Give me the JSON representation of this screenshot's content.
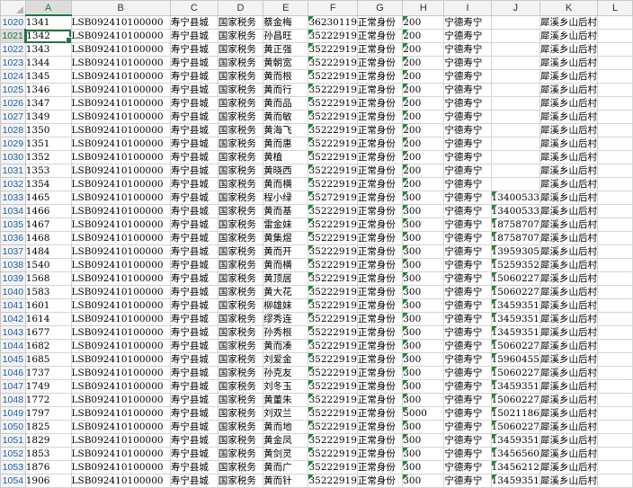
{
  "columns": [
    "A",
    "B",
    "C",
    "D",
    "E",
    "F",
    "G",
    "H",
    "I",
    "J",
    "K",
    "L"
  ],
  "active_cell": {
    "col": "A",
    "row": "1021"
  },
  "rows": [
    {
      "n": "1020",
      "A": "1341",
      "B": "LSB092410100000",
      "C": "寿宁县城",
      "D": "国家税务",
      "E": "蔡金梅",
      "F": "36230119",
      "G": "正常身份",
      "H": "200",
      "I": "宁德寿宁",
      "J": "",
      "K": "犀溪乡山后村",
      "L": "",
      "gf": true,
      "gh": true,
      "gj": false
    },
    {
      "n": "1021",
      "A": "1342",
      "B": "LSB092410100000",
      "C": "寿宁县城",
      "D": "国家税务",
      "E": "孙昌旺",
      "F": "35222919",
      "G": "正常身份",
      "H": "200",
      "I": "宁德寿宁",
      "J": "",
      "K": "犀溪乡山后村",
      "L": "",
      "gf": true,
      "gh": true,
      "gj": false
    },
    {
      "n": "1022",
      "A": "1343",
      "B": "LSB092410100000",
      "C": "寿宁县城",
      "D": "国家税务",
      "E": "黄正强",
      "F": "35222919",
      "G": "正常身份",
      "H": "200",
      "I": "宁德寿宁",
      "J": "",
      "K": "犀溪乡山后村",
      "L": "",
      "gf": true,
      "gh": true,
      "gj": false
    },
    {
      "n": "1023",
      "A": "1344",
      "B": "LSB092410100000",
      "C": "寿宁县城",
      "D": "国家税务",
      "E": "黄朝宽",
      "F": "35222919",
      "G": "正常身份",
      "H": "200",
      "I": "宁德寿宁",
      "J": "",
      "K": "犀溪乡山后村",
      "L": "",
      "gf": true,
      "gh": true,
      "gj": false
    },
    {
      "n": "1024",
      "A": "1345",
      "B": "LSB092410100000",
      "C": "寿宁县城",
      "D": "国家税务",
      "E": "黄而根",
      "F": "35222919",
      "G": "正常身份",
      "H": "200",
      "I": "宁德寿宁",
      "J": "",
      "K": "犀溪乡山后村",
      "L": "",
      "gf": true,
      "gh": true,
      "gj": false
    },
    {
      "n": "1025",
      "A": "1346",
      "B": "LSB092410100000",
      "C": "寿宁县城",
      "D": "国家税务",
      "E": "黄而行",
      "F": "35222919",
      "G": "正常身份",
      "H": "200",
      "I": "宁德寿宁",
      "J": "",
      "K": "犀溪乡山后村",
      "L": "",
      "gf": true,
      "gh": true,
      "gj": false
    },
    {
      "n": "1026",
      "A": "1347",
      "B": "LSB092410100000",
      "C": "寿宁县城",
      "D": "国家税务",
      "E": "黄而品",
      "F": "35222919",
      "G": "正常身份",
      "H": "200",
      "I": "宁德寿宁",
      "J": "",
      "K": "犀溪乡山后村",
      "L": "",
      "gf": true,
      "gh": true,
      "gj": false
    },
    {
      "n": "1027",
      "A": "1349",
      "B": "LSB092410100000",
      "C": "寿宁县城",
      "D": "国家税务",
      "E": "黄而敏",
      "F": "35222919",
      "G": "正常身份",
      "H": "200",
      "I": "宁德寿宁",
      "J": "",
      "K": "犀溪乡山后村",
      "L": "",
      "gf": true,
      "gh": true,
      "gj": false
    },
    {
      "n": "1028",
      "A": "1350",
      "B": "LSB092410100000",
      "C": "寿宁县城",
      "D": "国家税务",
      "E": "黄海飞",
      "F": "35222919",
      "G": "正常身份",
      "H": "200",
      "I": "宁德寿宁",
      "J": "",
      "K": "犀溪乡山后村",
      "L": "",
      "gf": true,
      "gh": true,
      "gj": false
    },
    {
      "n": "1029",
      "A": "1351",
      "B": "LSB092410100000",
      "C": "寿宁县城",
      "D": "国家税务",
      "E": "黄而惠",
      "F": "35222919",
      "G": "正常身份",
      "H": "200",
      "I": "宁德寿宁",
      "J": "",
      "K": "犀溪乡山后村",
      "L": "",
      "gf": true,
      "gh": true,
      "gj": false
    },
    {
      "n": "1030",
      "A": "1352",
      "B": "LSB092410100000",
      "C": "寿宁县城",
      "D": "国家税务",
      "E": "黄植",
      "F": "35222919",
      "G": "正常身份",
      "H": "200",
      "I": "宁德寿宁",
      "J": "",
      "K": "犀溪乡山后村",
      "L": "",
      "gf": true,
      "gh": true,
      "gj": false
    },
    {
      "n": "1031",
      "A": "1353",
      "B": "LSB092410100000",
      "C": "寿宁县城",
      "D": "国家税务",
      "E": "黄晓西",
      "F": "35222919",
      "G": "正常身份",
      "H": "200",
      "I": "宁德寿宁",
      "J": "",
      "K": "犀溪乡山后村",
      "L": "",
      "gf": true,
      "gh": true,
      "gj": false
    },
    {
      "n": "1032",
      "A": "1354",
      "B": "LSB092410100000",
      "C": "寿宁县城",
      "D": "国家税务",
      "E": "黄而横",
      "F": "35222919",
      "G": "正常身份",
      "H": "200",
      "I": "宁德寿宁",
      "J": "",
      "K": "犀溪乡山后村",
      "L": "",
      "gf": true,
      "gh": true,
      "gj": false
    },
    {
      "n": "1033",
      "A": "1465",
      "B": "LSB092410100000",
      "C": "寿宁县城",
      "D": "国家税务",
      "E": "程小绿",
      "F": "35272919",
      "G": "正常身份",
      "H": "300",
      "I": "宁德寿宁",
      "J": "13400533",
      "K": "犀溪乡山后村",
      "L": "",
      "gf": true,
      "gh": true,
      "gj": true
    },
    {
      "n": "1034",
      "A": "1466",
      "B": "LSB092410100000",
      "C": "寿宁县城",
      "D": "国家税务",
      "E": "黄而基",
      "F": "35222919",
      "G": "正常身份",
      "H": "300",
      "I": "宁德寿宁",
      "J": "13400533",
      "K": "犀溪乡山后村",
      "L": "",
      "gf": true,
      "gh": true,
      "gj": true
    },
    {
      "n": "1035",
      "A": "1467",
      "B": "LSB092410100000",
      "C": "寿宁县城",
      "D": "国家税务",
      "E": "雷金妹",
      "F": "35222919",
      "G": "正常身份",
      "H": "300",
      "I": "宁德寿宁",
      "J": "18758707",
      "K": "犀溪乡山后村",
      "L": "",
      "gf": true,
      "gh": true,
      "gj": true
    },
    {
      "n": "1036",
      "A": "1468",
      "B": "LSB092410100000",
      "C": "寿宁县城",
      "D": "国家税务",
      "E": "黄集煜",
      "F": "35222919",
      "G": "正常身份",
      "H": "300",
      "I": "宁德寿宁",
      "J": "18758707",
      "K": "犀溪乡山后村",
      "L": "",
      "gf": true,
      "gh": true,
      "gj": true
    },
    {
      "n": "1037",
      "A": "1484",
      "B": "LSB092410100000",
      "C": "寿宁县城",
      "D": "国家税务",
      "E": "黄而开",
      "F": "35222919",
      "G": "正常身份",
      "H": "300",
      "I": "宁德寿宁",
      "J": "13959305",
      "K": "犀溪乡山后村",
      "L": "",
      "gf": true,
      "gh": true,
      "gj": true
    },
    {
      "n": "1038",
      "A": "1540",
      "B": "LSB092410100000",
      "C": "寿宁县城",
      "D": "国家税务",
      "E": "黄而横",
      "F": "35222919",
      "G": "正常身份",
      "H": "300",
      "I": "宁德寿宁",
      "J": "15259352",
      "K": "犀溪乡山后村",
      "L": "",
      "gf": true,
      "gh": true,
      "gj": true
    },
    {
      "n": "1039",
      "A": "1568",
      "B": "LSB092410100000",
      "C": "寿宁县城",
      "D": "国家税务",
      "E": "黄顶居",
      "F": "35222919",
      "G": "正常身份",
      "H": "300",
      "I": "宁德寿宁",
      "J": "15060227",
      "K": "犀溪乡山后村",
      "L": "",
      "gf": true,
      "gh": true,
      "gj": true
    },
    {
      "n": "1040",
      "A": "1583",
      "B": "LSB092410100000",
      "C": "寿宁县城",
      "D": "国家税务",
      "E": "黄大花",
      "F": "35222919",
      "G": "正常身份",
      "H": "300",
      "I": "宁德寿宁",
      "J": "15060227",
      "K": "犀溪乡山后村",
      "L": "",
      "gf": true,
      "gh": true,
      "gj": true
    },
    {
      "n": "1041",
      "A": "1601",
      "B": "LSB092410100000",
      "C": "寿宁县城",
      "D": "国家税务",
      "E": "柳雄妹",
      "F": "35222919",
      "G": "正常身份",
      "H": "300",
      "I": "宁德寿宁",
      "J": "13459351",
      "K": "犀溪乡山后村",
      "L": "",
      "gf": true,
      "gh": true,
      "gj": true
    },
    {
      "n": "1042",
      "A": "1614",
      "B": "LSB092410100000",
      "C": "寿宁县城",
      "D": "国家税务",
      "E": "缪秀连",
      "F": "35222919",
      "G": "正常身份",
      "H": "300",
      "I": "宁德寿宁",
      "J": "13459351",
      "K": "犀溪乡山后村",
      "L": "",
      "gf": true,
      "gh": true,
      "gj": true
    },
    {
      "n": "1043",
      "A": "1677",
      "B": "LSB092410100000",
      "C": "寿宁县城",
      "D": "国家税务",
      "E": "孙秀根",
      "F": "35222919",
      "G": "正常身份",
      "H": "300",
      "I": "宁德寿宁",
      "J": "13459351",
      "K": "犀溪乡山后村",
      "L": "",
      "gf": true,
      "gh": true,
      "gj": true
    },
    {
      "n": "1044",
      "A": "1682",
      "B": "LSB092410100000",
      "C": "寿宁县城",
      "D": "国家税务",
      "E": "黄而凑",
      "F": "35222919",
      "G": "正常身份",
      "H": "300",
      "I": "宁德寿宁",
      "J": "15060227",
      "K": "犀溪乡山后村",
      "L": "",
      "gf": true,
      "gh": true,
      "gj": true
    },
    {
      "n": "1045",
      "A": "1685",
      "B": "LSB092410100000",
      "C": "寿宁县城",
      "D": "国家税务",
      "E": "刘爱金",
      "F": "35222919",
      "G": "正常身份",
      "H": "300",
      "I": "宁德寿宁",
      "J": "15960455",
      "K": "犀溪乡山后村",
      "L": "",
      "gf": true,
      "gh": true,
      "gj": true
    },
    {
      "n": "1046",
      "A": "1737",
      "B": "LSB092410100000",
      "C": "寿宁县城",
      "D": "国家税务",
      "E": "孙克友",
      "F": "35222919",
      "G": "正常身份",
      "H": "300",
      "I": "宁德寿宁",
      "J": "15060227",
      "K": "犀溪乡山后村",
      "L": "",
      "gf": true,
      "gh": true,
      "gj": true
    },
    {
      "n": "1047",
      "A": "1749",
      "B": "LSB092410100000",
      "C": "寿宁县城",
      "D": "国家税务",
      "E": "刘冬玉",
      "F": "35222919",
      "G": "正常身份",
      "H": "300",
      "I": "宁德寿宁",
      "J": "13459351",
      "K": "犀溪乡山后村",
      "L": "",
      "gf": true,
      "gh": true,
      "gj": true
    },
    {
      "n": "1048",
      "A": "1772",
      "B": "LSB092410100000",
      "C": "寿宁县城",
      "D": "国家税务",
      "E": "黄董朱",
      "F": "35222919",
      "G": "正常身份",
      "H": "300",
      "I": "宁德寿宁",
      "J": "15060227",
      "K": "犀溪乡山后村",
      "L": "",
      "gf": true,
      "gh": true,
      "gj": true
    },
    {
      "n": "1049",
      "A": "1797",
      "B": "LSB092410100000",
      "C": "寿宁县城",
      "D": "国家税务",
      "E": "刘双兰",
      "F": "35222919",
      "G": "正常身份",
      "H": "5000",
      "I": "宁德寿宁",
      "J": "15021186",
      "K": "犀溪乡山后村",
      "L": "",
      "gf": true,
      "gh": true,
      "gj": true
    },
    {
      "n": "1050",
      "A": "1825",
      "B": "LSB092410100000",
      "C": "寿宁县城",
      "D": "国家税务",
      "E": "黄而地",
      "F": "35222919",
      "G": "正常身份",
      "H": "300",
      "I": "宁德寿宁",
      "J": "15060227",
      "K": "犀溪乡山后村",
      "L": "",
      "gf": true,
      "gh": true,
      "gj": true
    },
    {
      "n": "1051",
      "A": "1829",
      "B": "LSB092410100000",
      "C": "寿宁县城",
      "D": "国家税务",
      "E": "黄金凤",
      "F": "35222919",
      "G": "正常身份",
      "H": "300",
      "I": "宁德寿宁",
      "J": "13459351",
      "K": "犀溪乡山后村",
      "L": "",
      "gf": true,
      "gh": true,
      "gj": true
    },
    {
      "n": "1052",
      "A": "1853",
      "B": "LSB092410100000",
      "C": "寿宁县城",
      "D": "国家税务",
      "E": "黄剑灵",
      "F": "35222919",
      "G": "正常身份",
      "H": "300",
      "I": "宁德寿宁",
      "J": "13456560",
      "K": "犀溪乡山后村",
      "L": "",
      "gf": true,
      "gh": true,
      "gj": true
    },
    {
      "n": "1053",
      "A": "1876",
      "B": "LSB092410100000",
      "C": "寿宁县城",
      "D": "国家税务",
      "E": "黄而广",
      "F": "35222919",
      "G": "正常身份",
      "H": "300",
      "I": "宁德寿宁",
      "J": "13456212",
      "K": "犀溪乡山后村",
      "L": "",
      "gf": true,
      "gh": true,
      "gj": true
    },
    {
      "n": "1054",
      "A": "1906",
      "B": "LSB092410100000",
      "C": "寿宁县城",
      "D": "国家税务",
      "E": "黄而针",
      "F": "35222919",
      "G": "正常身份",
      "H": "300",
      "I": "宁德寿宁",
      "J": "13459351",
      "K": "犀溪乡山后村",
      "L": "",
      "gf": true,
      "gh": true,
      "gj": true
    }
  ],
  "colors": {
    "accent": "#217346",
    "error_indicator": "#1e8a2e",
    "row_header_text": "#2060a8"
  }
}
